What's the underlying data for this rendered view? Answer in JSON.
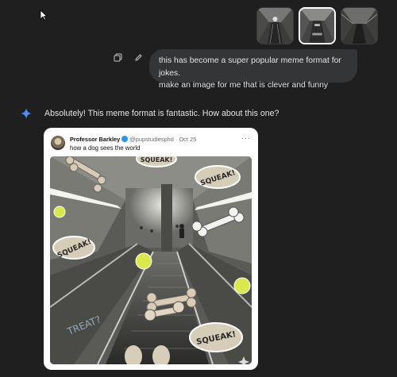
{
  "user_message": {
    "lines": [
      "this has become a super popular meme format for jokes.",
      "make an image for me that is clever and funny"
    ]
  },
  "assistant": {
    "reply": "Absolutely! This meme format is fantastic. How about this one?"
  },
  "tweet": {
    "author": "Professor Barkley",
    "handle": "@pupstudiesphd",
    "date": "Oct 25",
    "text": "how a dog sees the world",
    "stickers": [
      "SQUEAK!",
      "SQUEAK!",
      "SQUEAK!",
      "SQUEAK!",
      "TREAT?"
    ]
  },
  "icons": [
    "cursor-icon",
    "copy-icon",
    "edit-icon",
    "gemini-spark-icon",
    "verified-icon",
    "more-icon"
  ],
  "colors": {
    "background": "#1f1f1f",
    "bubble": "#333537",
    "spark": "#4b8df8",
    "verified": "#1d9bf0"
  }
}
